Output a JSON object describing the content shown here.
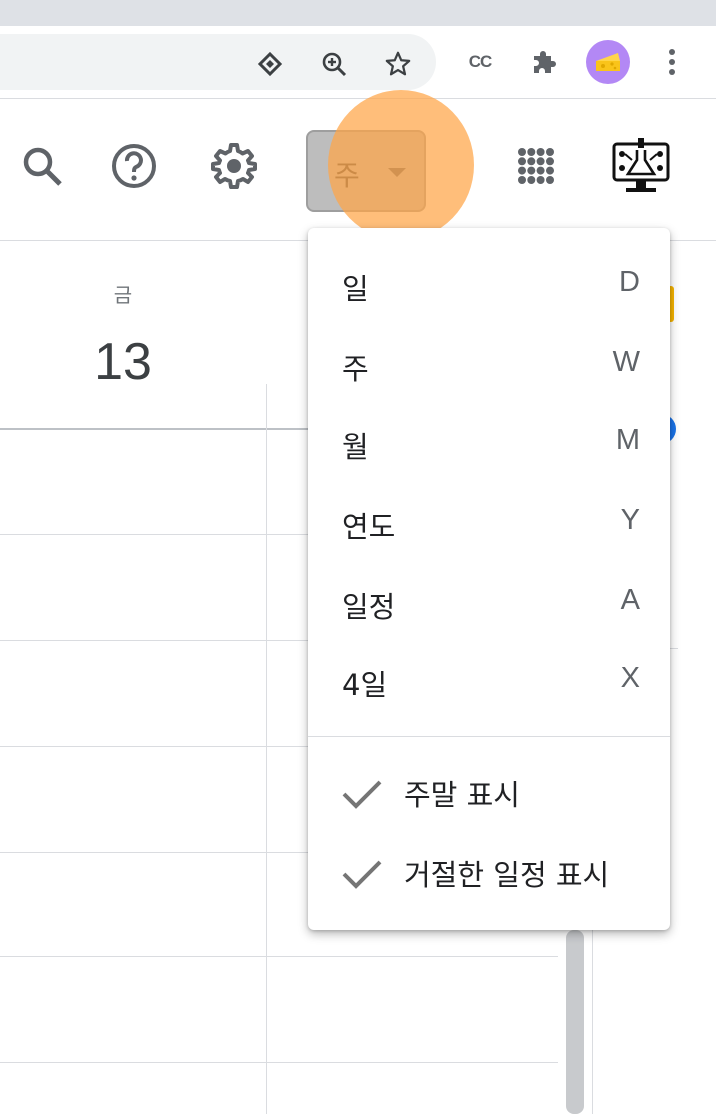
{
  "browser": {
    "toolbar_icons": [
      "lens-icon",
      "zoom-icon",
      "bookmark-star-icon"
    ],
    "extension_cc_label": "CC",
    "extensions": [
      "puzzle-extensions-icon"
    ],
    "profile_icon": "cheese-avatar-icon",
    "menu_icon": "kebab-menu-icon"
  },
  "calendar": {
    "header_icons": [
      "search-icon",
      "help-icon",
      "settings-gear-icon",
      "apps-grid-icon"
    ],
    "view_selector": {
      "label": "주",
      "caret": "caret-down-icon"
    },
    "day": {
      "name": "금",
      "number": "13"
    },
    "accent_colors": {
      "click_marker": "#ffa546",
      "orange_event": "#f6b400",
      "blue_event": "#1a73e8"
    }
  },
  "view_menu": {
    "items": [
      {
        "label": "일",
        "key": "D"
      },
      {
        "label": "주",
        "key": "W"
      },
      {
        "label": "월",
        "key": "M"
      },
      {
        "label": "연도",
        "key": "Y"
      },
      {
        "label": "일정",
        "key": "A"
      },
      {
        "label": "4일",
        "key": "X"
      }
    ],
    "options": [
      {
        "label": "주말 표시",
        "checked": true
      },
      {
        "label": "거절한 일정 표시",
        "checked": true
      }
    ]
  }
}
